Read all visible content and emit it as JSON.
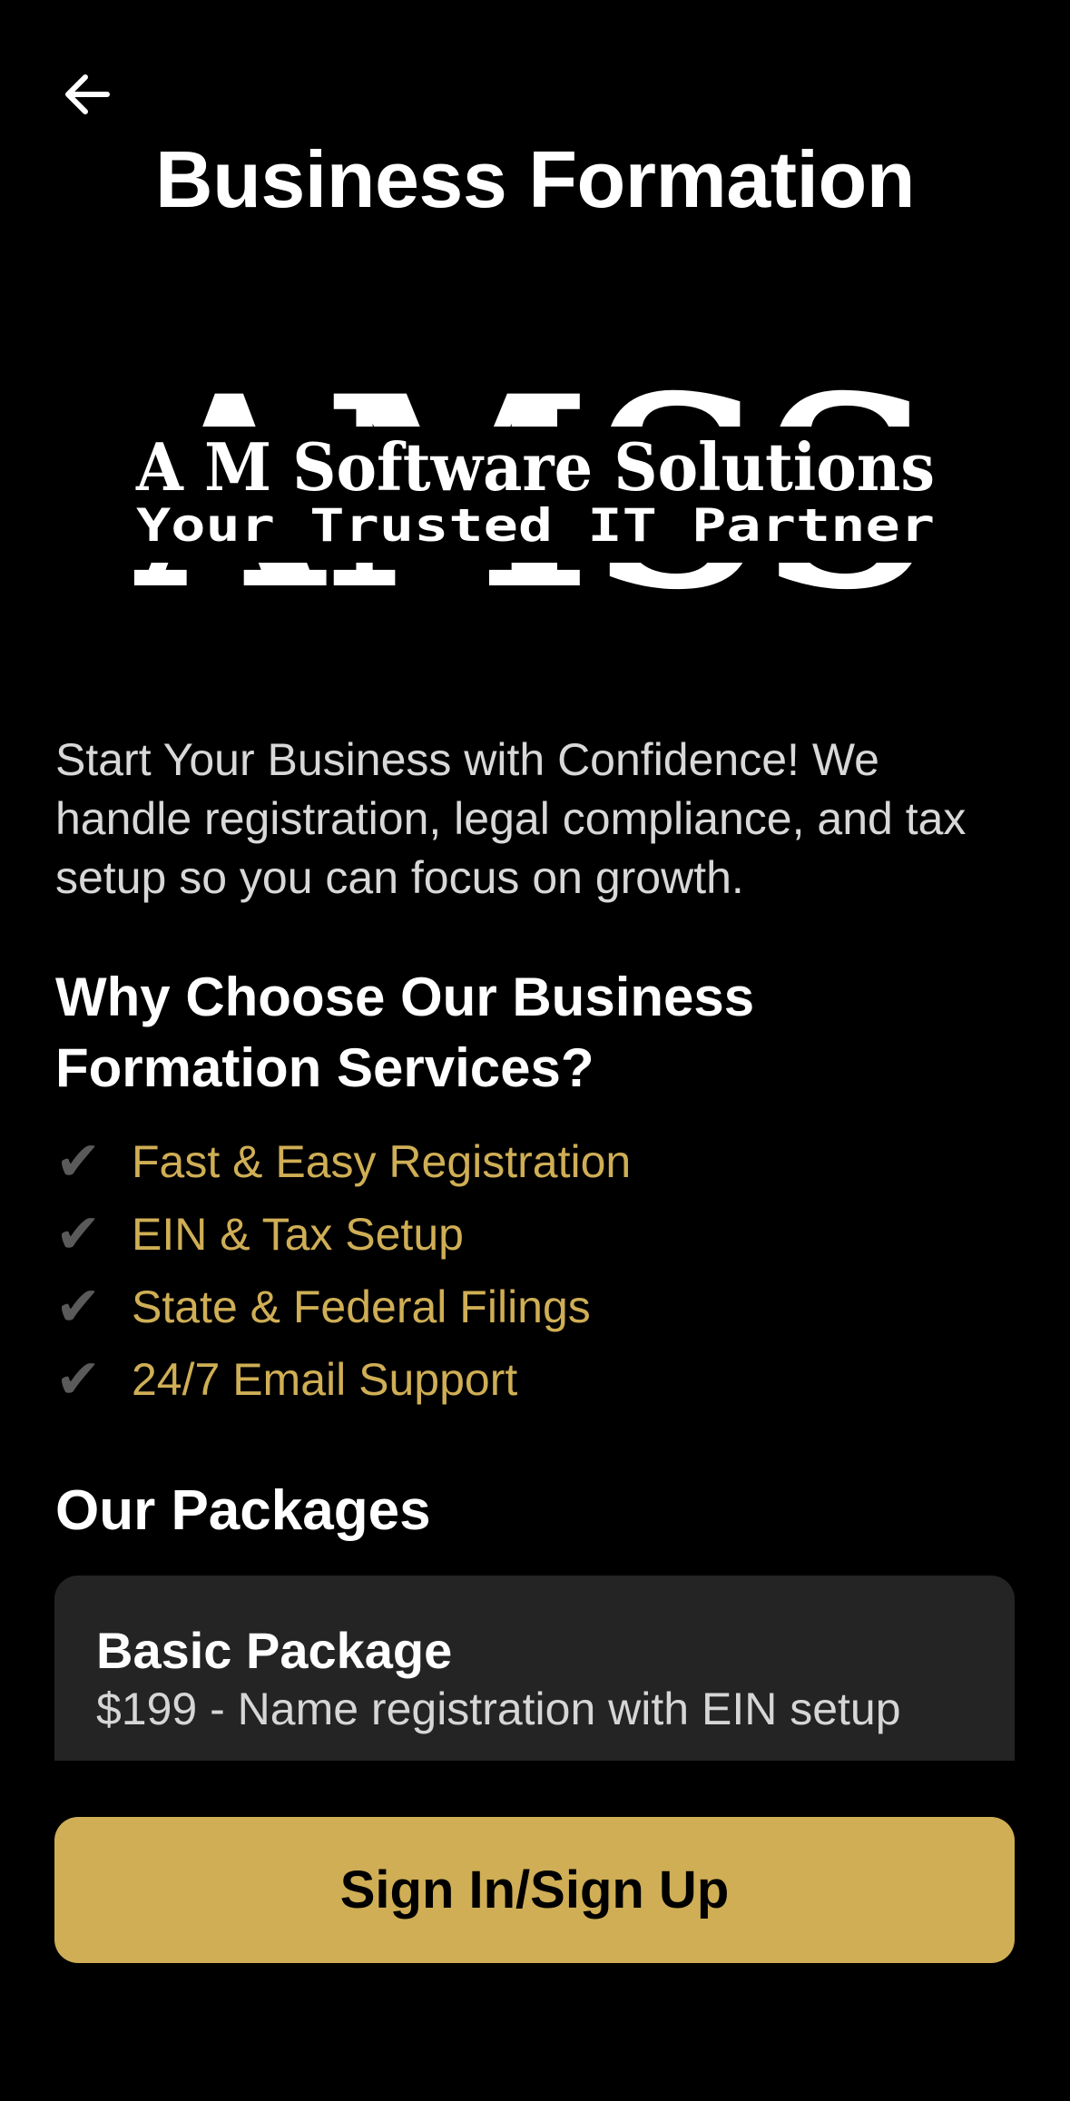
{
  "header": {
    "title": "Business Formation",
    "back_icon": "arrow-left-icon"
  },
  "logo": {
    "monogram": "AMSS",
    "company_name": "A M Software Solutions",
    "tagline": "Your Trusted IT Partner"
  },
  "intro": {
    "text": "Start Your Business with Confidence! We handle registration, legal compliance, and tax setup so you can focus on growth."
  },
  "why_section": {
    "heading": "Why Choose Our Business Formation Services?",
    "check_icon": "checkmark-icon",
    "features": [
      {
        "check": "✔",
        "label": "Fast & Easy Registration"
      },
      {
        "check": "✔",
        "label": "EIN & Tax Setup"
      },
      {
        "check": "✔",
        "label": "State & Federal Filings"
      },
      {
        "check": "✔",
        "label": "24/7 Email Support"
      }
    ]
  },
  "packages": {
    "heading": "Our Packages",
    "items": [
      {
        "name": "Basic Package",
        "description": "$199 - Name registration with EIN setup"
      }
    ]
  },
  "cta": {
    "label": "Sign In/Sign Up"
  },
  "colors": {
    "background": "#000000",
    "accent_gold": "#cfae55",
    "card_bg": "#242424",
    "check_gray": "#5a5a5a"
  }
}
